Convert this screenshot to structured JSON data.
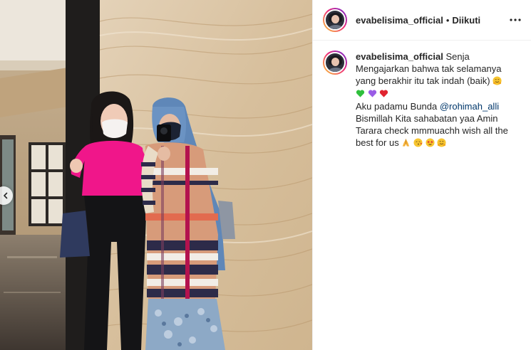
{
  "header": {
    "username": "evabelisima_official",
    "separator": "•",
    "follow_status": "Diikuti",
    "more_icon": "more-options-icon"
  },
  "caption": {
    "username": "evabelisima_official",
    "line1": "Senja Mengajarkan bahwa tak selamanya yang berakhir itu tak indah (baik)",
    "line2_prefix": "Aku padamu Bunda ",
    "mention": "@rohimah_alli",
    "line3": "Bismillah Kita sahabatan yaa Amin Tarara check mmmuachh wish all the best for us",
    "emojis_line1": [
      "hugging-face"
    ],
    "hearts": [
      "green-heart",
      "purple-heart",
      "red-heart"
    ],
    "emojis_end": [
      "folded-hands",
      "face-blowing-kiss",
      "star-struck",
      "hugging-face"
    ]
  },
  "media": {
    "alt": "Two women posing in front of a marble wall",
    "prev_icon": "chevron-left-icon"
  },
  "colors": {
    "link": "#00376b",
    "text": "#262626",
    "border": "#efefef",
    "ring_start": "#f9ce34",
    "ring_mid": "#ee2a7b",
    "ring_end": "#6228d7"
  }
}
